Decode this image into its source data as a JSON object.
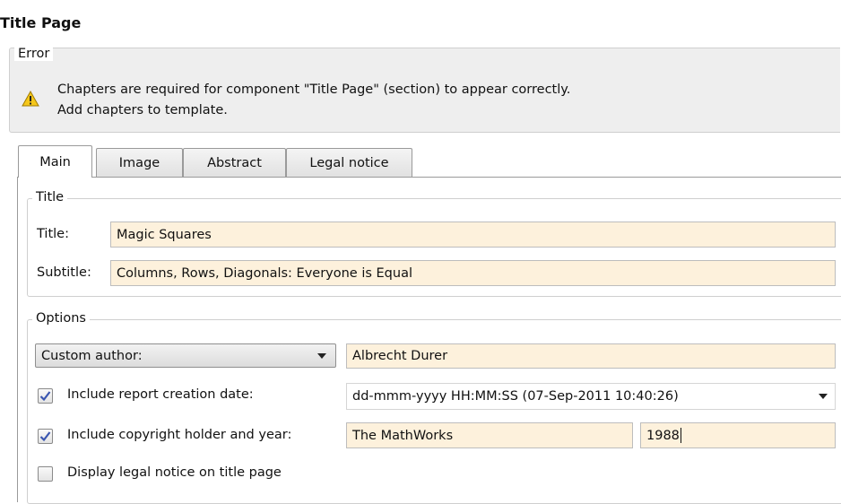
{
  "page": {
    "title": "Title Page"
  },
  "error": {
    "legend": "Error",
    "line1": "Chapters are required for component \"Title Page\" (section) to appear correctly.",
    "line2": "Add chapters to template.",
    "icon": "warning-icon"
  },
  "tabs": [
    {
      "label": "Main",
      "active": true
    },
    {
      "label": "Image",
      "active": false
    },
    {
      "label": "Abstract",
      "active": false
    },
    {
      "label": "Legal notice",
      "active": false
    }
  ],
  "title_group": {
    "legend": "Title",
    "title_label": "Title:",
    "title_value": "Magic Squares",
    "subtitle_label": "Subtitle:",
    "subtitle_value": "Columns, Rows, Diagonals: Everyone is Equal"
  },
  "options": {
    "legend": "Options",
    "author_mode": "Custom author:",
    "author_value": "Albrecht Durer",
    "include_date": {
      "label": "Include report creation date:",
      "checked": true
    },
    "date_format": "dd-mmm-yyyy HH:MM:SS (07-Sep-2011 10:40:26)",
    "include_copyright": {
      "label": "Include copyright holder and year:",
      "checked": true
    },
    "copyright_holder": "The MathWorks",
    "copyright_year": "1988",
    "display_legal": {
      "label": "Display legal notice on title page",
      "checked": false
    }
  },
  "colors": {
    "field_bg": "#fdf1dc",
    "check_mark": "#3a56b0"
  }
}
